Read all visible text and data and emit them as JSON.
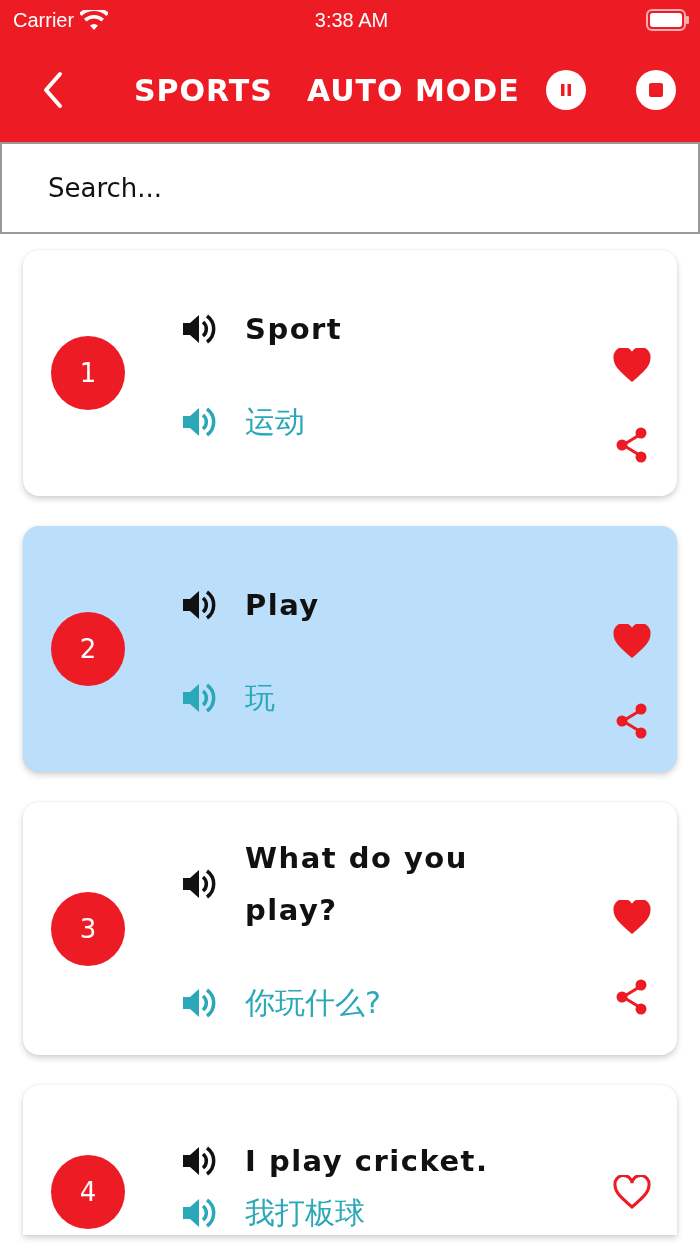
{
  "status_bar": {
    "carrier": "Carrier",
    "time": "3:38 AM"
  },
  "header": {
    "title": "SPORTS",
    "mode": "AUTO MODE"
  },
  "search": {
    "placeholder": "Search..."
  },
  "phrases": [
    {
      "number": "1",
      "english": "Sport",
      "chinese": "运动",
      "favorite": true,
      "selected": false
    },
    {
      "number": "2",
      "english": "Play",
      "chinese": "玩",
      "favorite": true,
      "selected": true
    },
    {
      "number": "3",
      "english": "What do you play?",
      "chinese": "你玩什么?",
      "favorite": true,
      "selected": false
    },
    {
      "number": "4",
      "english": "I play cricket.",
      "chinese": "我打板球",
      "favorite": false,
      "selected": false
    }
  ]
}
